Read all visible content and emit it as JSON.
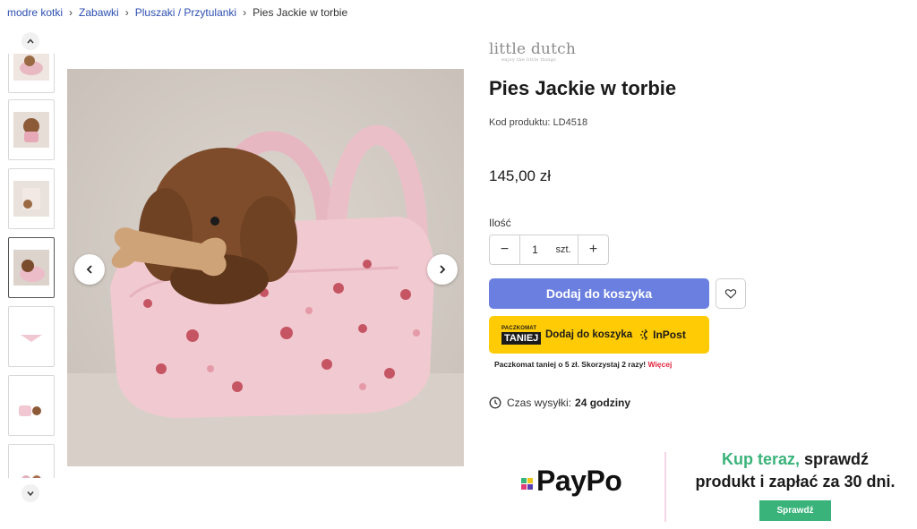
{
  "breadcrumb": {
    "items": [
      "modre kotki",
      "Zabawki",
      "Pluszaki / Przytulanki"
    ],
    "current": "Pies Jackie w torbie"
  },
  "gallery": {
    "thumbnail_count": 8,
    "active_index": 3
  },
  "brand": {
    "name": "little dutch",
    "tagline": "enjoy the little things"
  },
  "product": {
    "title": "Pies Jackie w torbie",
    "code_label": "Kod produktu: LD4518",
    "price": "145,00 zł"
  },
  "quantity": {
    "label": "Ilość",
    "value": "1",
    "unit": "szt.",
    "minus": "−",
    "plus": "+"
  },
  "cart": {
    "add_label": "Dodaj do koszyka"
  },
  "inpost": {
    "badge_top": "PACZKOMAT",
    "badge_bottom": "TANIEJ",
    "label": "Dodaj do koszyka",
    "logo_text": "InPost",
    "note": "Paczkomat taniej o 5 zł. Skorzystaj 2 razy!",
    "note_link": "Więcej"
  },
  "shipping": {
    "label": "Czas wysyłki:",
    "value": "24 godziny"
  },
  "paypo": {
    "logo_text": "PayPo",
    "headline_accent": "Kup teraz,",
    "headline_rest_1": "sprawdź",
    "headline_line_2": "produkt i zapłać za 30 dni.",
    "cta_label": "Sprawdź"
  },
  "colors": {
    "primary_button": "#6b7fe0",
    "inpost_yellow": "#ffcb05",
    "paypo_green": "#3ab37a",
    "link_blue": "#2c4fb0",
    "link_red": "#e2243b"
  }
}
